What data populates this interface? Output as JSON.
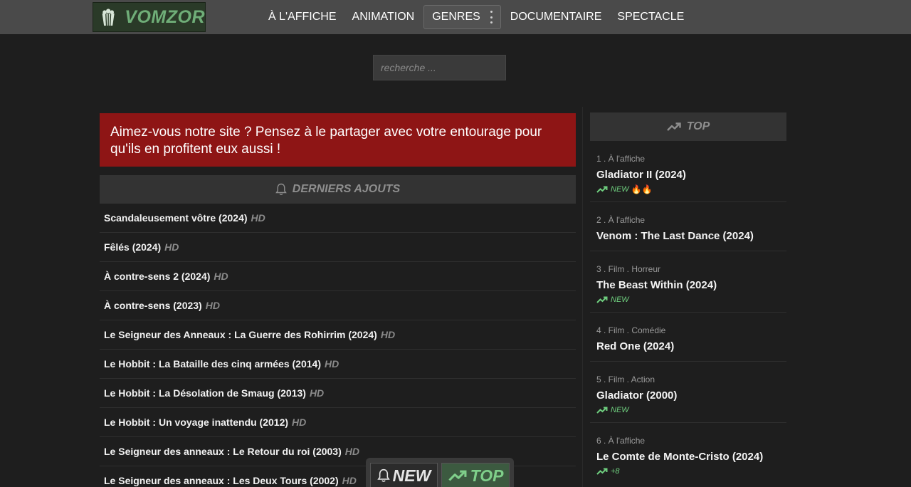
{
  "header": {
    "logo_text": "VOMZOR",
    "nav": [
      {
        "label": "À L'AFFICHE"
      },
      {
        "label": "ANIMATION"
      },
      {
        "label": "GENRES"
      },
      {
        "label": "DOCUMENTAIRE"
      },
      {
        "label": "SPECTACLE"
      }
    ]
  },
  "search": {
    "placeholder": "recherche ..."
  },
  "banner": {
    "text": "Aimez-vous notre site ? Pensez à le partager avec votre entourage pour qu'ils en profitent eux aussi !"
  },
  "latest": {
    "title": "DERNIERS AJOUTS",
    "items": [
      {
        "title": "Scandaleusement vôtre (2024)",
        "quality": "HD"
      },
      {
        "title": "Fêlés (2024)",
        "quality": "HD"
      },
      {
        "title": "À contre-sens 2 (2024)",
        "quality": "HD"
      },
      {
        "title": "À contre-sens (2023)",
        "quality": "HD"
      },
      {
        "title": "Le Seigneur des Anneaux : La Guerre des Rohirrim (2024)",
        "quality": "HD"
      },
      {
        "title": "Le Hobbit : La Bataille des cinq armées (2014)",
        "quality": "HD"
      },
      {
        "title": "Le Hobbit : La Désolation de Smaug (2013)",
        "quality": "HD"
      },
      {
        "title": "Le Hobbit : Un voyage inattendu (2012)",
        "quality": "HD"
      },
      {
        "title": "Le Seigneur des anneaux : Le Retour du roi (2003)",
        "quality": "HD"
      },
      {
        "title": "Le Seigneur des anneaux : Les Deux Tours (2002)",
        "quality": "HD"
      }
    ]
  },
  "top": {
    "title": "TOP",
    "items": [
      {
        "meta": "1 . À l'affiche",
        "title": "Gladiator II (2024)",
        "badge": "NEW",
        "extra": "🔥🔥"
      },
      {
        "meta": "2 . À l'affiche",
        "title": "Venom : The Last Dance (2024)",
        "badge": "",
        "extra": ""
      },
      {
        "meta": "3 . Film . Horreur",
        "title": "The Beast Within (2024)",
        "badge": "NEW",
        "extra": ""
      },
      {
        "meta": "4 . Film . Comédie",
        "title": "Red One (2024)",
        "badge": "",
        "extra": ""
      },
      {
        "meta": "5 . Film . Action",
        "title": "Gladiator (2000)",
        "badge": "NEW",
        "extra": ""
      },
      {
        "meta": "6 . À l'affiche",
        "title": "Le Comte de Monte-Cristo (2024)",
        "badge": "+8",
        "extra": ""
      }
    ]
  },
  "float_toggle": {
    "new_label": "NEW",
    "top_label": "TOP"
  },
  "colors": {
    "banner": "#8e1515",
    "accent_green": "#6fcf7f",
    "header_bg": "#4a4a4a",
    "page_bg": "#1e1e1e"
  }
}
